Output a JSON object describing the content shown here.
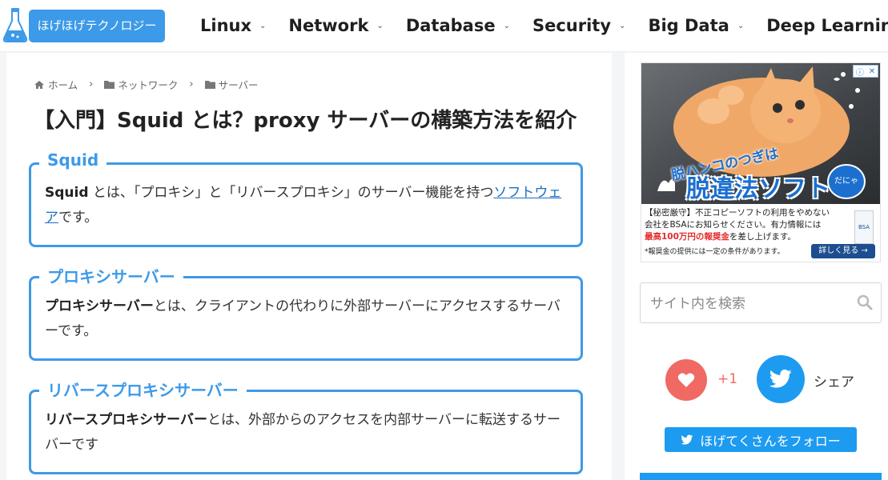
{
  "header": {
    "logo_text": "ほげほげテクノロジー",
    "nav": [
      {
        "label": "Linux"
      },
      {
        "label": "Network"
      },
      {
        "label": "Database"
      },
      {
        "label": "Security"
      },
      {
        "label": "Big Data"
      },
      {
        "label": "Deep Learning"
      }
    ]
  },
  "breadcrumb": {
    "home": "ホーム",
    "cat1": "ネットワーク",
    "cat2": "サーバー"
  },
  "article": {
    "title": "【入門】Squid とは？proxy サーバーの構築方法を紹介",
    "sections": [
      {
        "heading": "Squid",
        "term": "Squid",
        "text_before": " とは、「プロキシ」と「リバースプロキシ」のサーバー機能を持つ",
        "link": "ソフトウェア",
        "text_after": "です。"
      },
      {
        "heading": "プロキシサーバー",
        "term": "プロキシサーバー",
        "text": "とは、クライアントの代わりに外部サーバーにアクセスするサーバーです。"
      },
      {
        "heading": "リバースプロキシサーバー",
        "term": "リバースプロキシサーバー",
        "text": "とは、外部からのアクセスを内部サーバーに転送するサーバーです"
      }
    ]
  },
  "ad": {
    "slogan_small": "脱ハンコのつぎは",
    "slogan": "脱違法ソフト",
    "badge": "だにゃ",
    "line1_bracket": "【秘密厳守】",
    "line1": "不正コピーソフトの利用をやめない",
    "line2": "会社をBSAにお知らせください。有力情報には",
    "line3_red": "最高100万円の報奨金",
    "line3": "を差し上げます。",
    "note": "*報奨金の提供には一定の条件があります。",
    "more_label": "詳しく見る →",
    "bsa_label": "BSA"
  },
  "search": {
    "placeholder": "サイト内を検索"
  },
  "share": {
    "like_count": "+1",
    "share_label": "シェア",
    "follow_label": "ほげてくさんをフォロー"
  }
}
